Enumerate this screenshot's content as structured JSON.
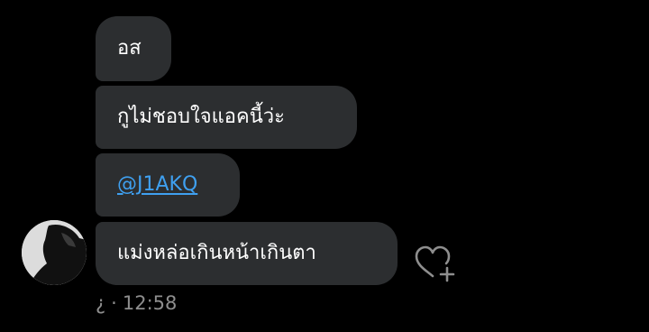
{
  "messages": [
    {
      "text": "อส"
    },
    {
      "text": "กูไม่ชอบใจแอคนี้ว่ะ"
    },
    {
      "text": "@J1AKQ"
    },
    {
      "text": "แม่งหล่อเกินหน้าเกินตา"
    }
  ],
  "footer": {
    "status_glyph": "¿",
    "separator": "·",
    "time": "12:58"
  },
  "icons": {
    "reaction": "heart-plus-icon",
    "avatar": "profile-photo"
  },
  "colors": {
    "background": "#000000",
    "bubble": "#2c2e30",
    "text": "#ffffff",
    "mention": "#3fa0f0",
    "meta": "#8e8e8e"
  }
}
